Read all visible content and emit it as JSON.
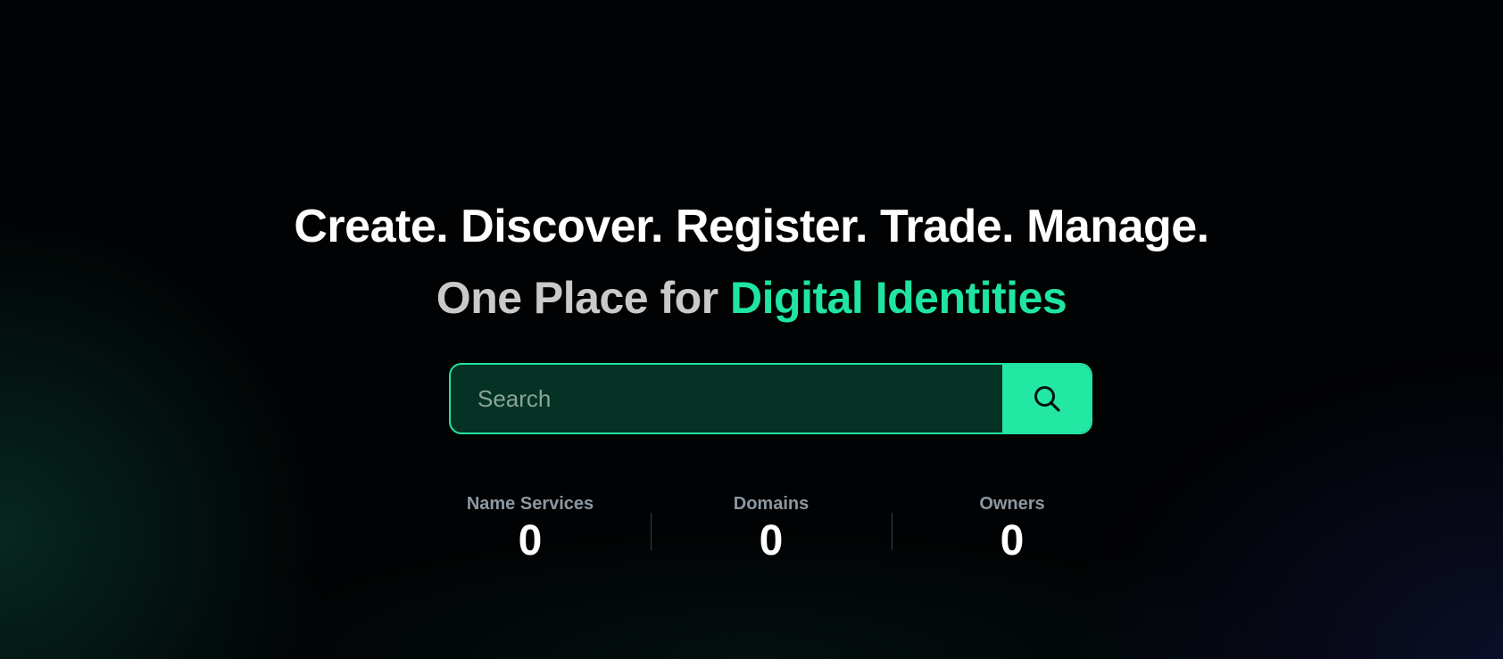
{
  "hero": {
    "headline": "Create. Discover. Register. Trade. Manage.",
    "subheadline_prefix": "One Place for ",
    "subheadline_accent": "Digital Identities"
  },
  "search": {
    "placeholder": "Search",
    "value": "",
    "button_icon": "search-icon"
  },
  "stats": [
    {
      "label": "Name Services",
      "value": "0"
    },
    {
      "label": "Domains",
      "value": "0"
    },
    {
      "label": "Owners",
      "value": "0"
    }
  ],
  "colors": {
    "accent": "#1fe5a0",
    "background": "#010203",
    "search_field_bg": "#063226",
    "muted_label": "#8c98a2"
  }
}
